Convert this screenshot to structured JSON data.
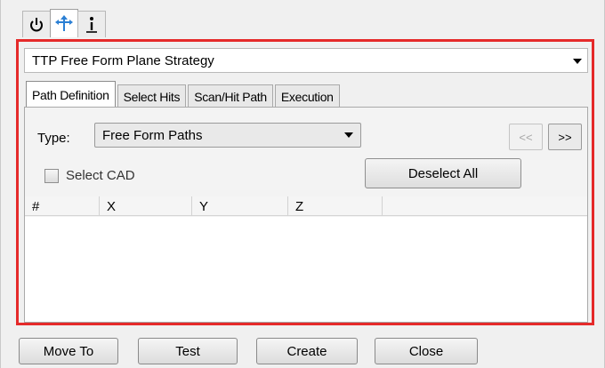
{
  "top_tabs": [
    {
      "icon": "power-icon"
    },
    {
      "icon": "move-arrows-icon"
    },
    {
      "icon": "info-icon"
    }
  ],
  "strategy": {
    "value": "TTP Free Form Plane Strategy"
  },
  "tabs": [
    {
      "label": "Path Definition"
    },
    {
      "label": "Select Hits"
    },
    {
      "label": "Scan/Hit Path"
    },
    {
      "label": "Execution"
    }
  ],
  "path_definition": {
    "type_label": "Type:",
    "type_value": "Free Form Paths",
    "prev_label": "<<",
    "next_label": ">>",
    "select_cad_label": "Select CAD",
    "deselect_all_label": "Deselect All"
  },
  "grid": {
    "columns": [
      "#",
      "X",
      "Y",
      "Z"
    ]
  },
  "buttons": {
    "move_to": "Move To",
    "test": "Test",
    "create": "Create",
    "close": "Close"
  },
  "colors": {
    "highlight": "#e52a2a",
    "icon_blue": "#2a7fd4"
  }
}
